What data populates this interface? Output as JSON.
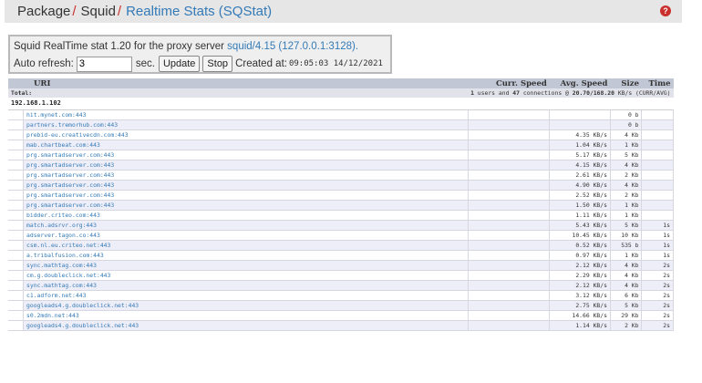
{
  "breadcrumb": {
    "items": [
      "Package",
      "Squid"
    ],
    "separator": "/",
    "active": "Realtime Stats (SQStat)"
  },
  "help_icon": "question-circle-icon",
  "info": {
    "text_prefix": "Squid RealTime stat 1.20 for the proxy server",
    "server_link": "squid/4.15 (127.0.0.1:3128).",
    "auto_refresh_label": "Auto refresh:",
    "auto_refresh_value": "3",
    "sec_label": "sec.",
    "update_button": "Update",
    "stop_button": "Stop",
    "created_at_label": "Created at:",
    "created_at_value": "09:05:03 14/12/2021"
  },
  "table": {
    "columns": [
      "URI",
      "Curr. Speed",
      "Avg. Speed",
      "Size",
      "Time"
    ],
    "total_label": "Total:",
    "total_summary": {
      "users": "1",
      "users_text": "users and",
      "connections": "47",
      "connections_text": "connections @",
      "speed": "20.70/168.20",
      "speed_text": "KB/s (CURR/AVG)"
    },
    "ip": "192.168.1.102",
    "rows": [
      {
        "uri": "hit.mynet.com:443",
        "curr": "",
        "avg": "",
        "size": "0 b",
        "time": ""
      },
      {
        "uri": "partners.tremorhub.com:443",
        "curr": "",
        "avg": "",
        "size": "0 b",
        "time": ""
      },
      {
        "uri": "prebid-eu.creativecdn.com:443",
        "curr": "",
        "avg": "4.35 KB/s",
        "size": "4 Kb",
        "time": ""
      },
      {
        "uri": "mab.chartbeat.com:443",
        "curr": "",
        "avg": "1.04 KB/s",
        "size": "1 Kb",
        "time": ""
      },
      {
        "uri": "prg.smartadserver.com:443",
        "curr": "",
        "avg": "5.17 KB/s",
        "size": "5 Kb",
        "time": ""
      },
      {
        "uri": "prg.smartadserver.com:443",
        "curr": "",
        "avg": "4.15 KB/s",
        "size": "4 Kb",
        "time": ""
      },
      {
        "uri": "prg.smartadserver.com:443",
        "curr": "",
        "avg": "2.61 KB/s",
        "size": "2 Kb",
        "time": ""
      },
      {
        "uri": "prg.smartadserver.com:443",
        "curr": "",
        "avg": "4.90 KB/s",
        "size": "4 Kb",
        "time": ""
      },
      {
        "uri": "prg.smartadserver.com:443",
        "curr": "",
        "avg": "2.52 KB/s",
        "size": "2 Kb",
        "time": ""
      },
      {
        "uri": "prg.smartadserver.com:443",
        "curr": "",
        "avg": "1.50 KB/s",
        "size": "1 Kb",
        "time": ""
      },
      {
        "uri": "bidder.criteo.com:443",
        "curr": "",
        "avg": "1.11 KB/s",
        "size": "1 Kb",
        "time": ""
      },
      {
        "uri": "match.adsrvr.org:443",
        "curr": "",
        "avg": "5.43 KB/s",
        "size": "5 Kb",
        "time": "1s"
      },
      {
        "uri": "adserver.tagon.co:443",
        "curr": "",
        "avg": "10.45 KB/s",
        "size": "10 Kb",
        "time": "1s"
      },
      {
        "uri": "csm.nl.eu.criteo.net:443",
        "curr": "",
        "avg": "0.52 KB/s",
        "size": "535 b",
        "time": "1s"
      },
      {
        "uri": "a.tribalfusion.com:443",
        "curr": "",
        "avg": "0.97 KB/s",
        "size": "1 Kb",
        "time": "1s"
      },
      {
        "uri": "sync.mathtag.com:443",
        "curr": "",
        "avg": "2.12 KB/s",
        "size": "4 Kb",
        "time": "2s"
      },
      {
        "uri": "cm.g.doubleclick.net:443",
        "curr": "",
        "avg": "2.29 KB/s",
        "size": "4 Kb",
        "time": "2s"
      },
      {
        "uri": "sync.mathtag.com:443",
        "curr": "",
        "avg": "2.12 KB/s",
        "size": "4 Kb",
        "time": "2s"
      },
      {
        "uri": "c1.adform.net:443",
        "curr": "",
        "avg": "3.12 KB/s",
        "size": "6 Kb",
        "time": "2s"
      },
      {
        "uri": "googleads4.g.doubleclick.net:443",
        "curr": "",
        "avg": "2.75 KB/s",
        "size": "5 Kb",
        "time": "2s"
      },
      {
        "uri": "s0.2mdn.net:443",
        "curr": "",
        "avg": "14.66 KB/s",
        "size": "29 Kb",
        "time": "2s"
      },
      {
        "uri": "googleads4.g.doubleclick.net:443",
        "curr": "",
        "avg": "1.14 KB/s",
        "size": "2 Kb",
        "time": "2s"
      }
    ]
  },
  "colors": {
    "link": "#337ab7",
    "separator": "#c9302c",
    "header_bg": "#c2c7d6",
    "row_alt": "#eeeef8"
  }
}
